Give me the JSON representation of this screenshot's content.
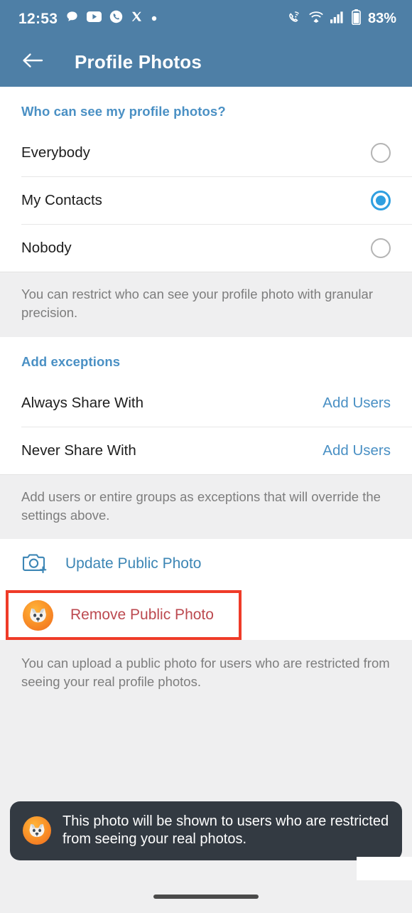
{
  "status_bar": {
    "time": "12:53",
    "battery_percent": "83%",
    "left_icons": [
      "chat-bubble-icon",
      "youtube-icon",
      "phone-circle-icon",
      "x-twitter-icon",
      "dot-icon"
    ],
    "right_icons": [
      "call-over-wifi-icon",
      "wifi-icon",
      "cellular-signal-icon",
      "battery-icon"
    ],
    "bar_color": "#4e7fa6"
  },
  "app_bar": {
    "back_icon": "arrow-left-icon",
    "title": "Profile Photos",
    "bar_color": "#4e7fa6"
  },
  "visibility_section": {
    "header": "Who can see my profile photos?",
    "options": [
      {
        "label": "Everybody",
        "selected": false
      },
      {
        "label": "My Contacts",
        "selected": true
      },
      {
        "label": "Nobody",
        "selected": false
      }
    ],
    "note": "You can restrict who can see your profile photo with granular precision.",
    "accent_color": "#4a90c4",
    "selected_radio_color": "#2f9fe0"
  },
  "exceptions_section": {
    "header": "Add exceptions",
    "rows": [
      {
        "label": "Always Share With",
        "action": "Add Users"
      },
      {
        "label": "Never Share With",
        "action": "Add Users"
      }
    ],
    "note": "Add users or entire groups as exceptions that will override the settings above."
  },
  "public_photo_section": {
    "update": {
      "icon": "camera-plus-icon",
      "label": "Update Public Photo",
      "color": "#3d86b5"
    },
    "remove": {
      "icon": "fox-avatar-icon",
      "label": "Remove Public Photo",
      "color": "#bc4a50",
      "highlighted": true,
      "highlight_color": "#ef3b28"
    },
    "note": "You can upload a public photo for users who are restricted from seeing your real profile photos."
  },
  "toast": {
    "avatar_icon": "fox-avatar-icon",
    "message": "This photo will be shown to users who are restricted from seeing your real photos.",
    "background_color": "#333a42"
  },
  "nav_bar": {
    "gesture_handle": "home-gesture-pill"
  }
}
